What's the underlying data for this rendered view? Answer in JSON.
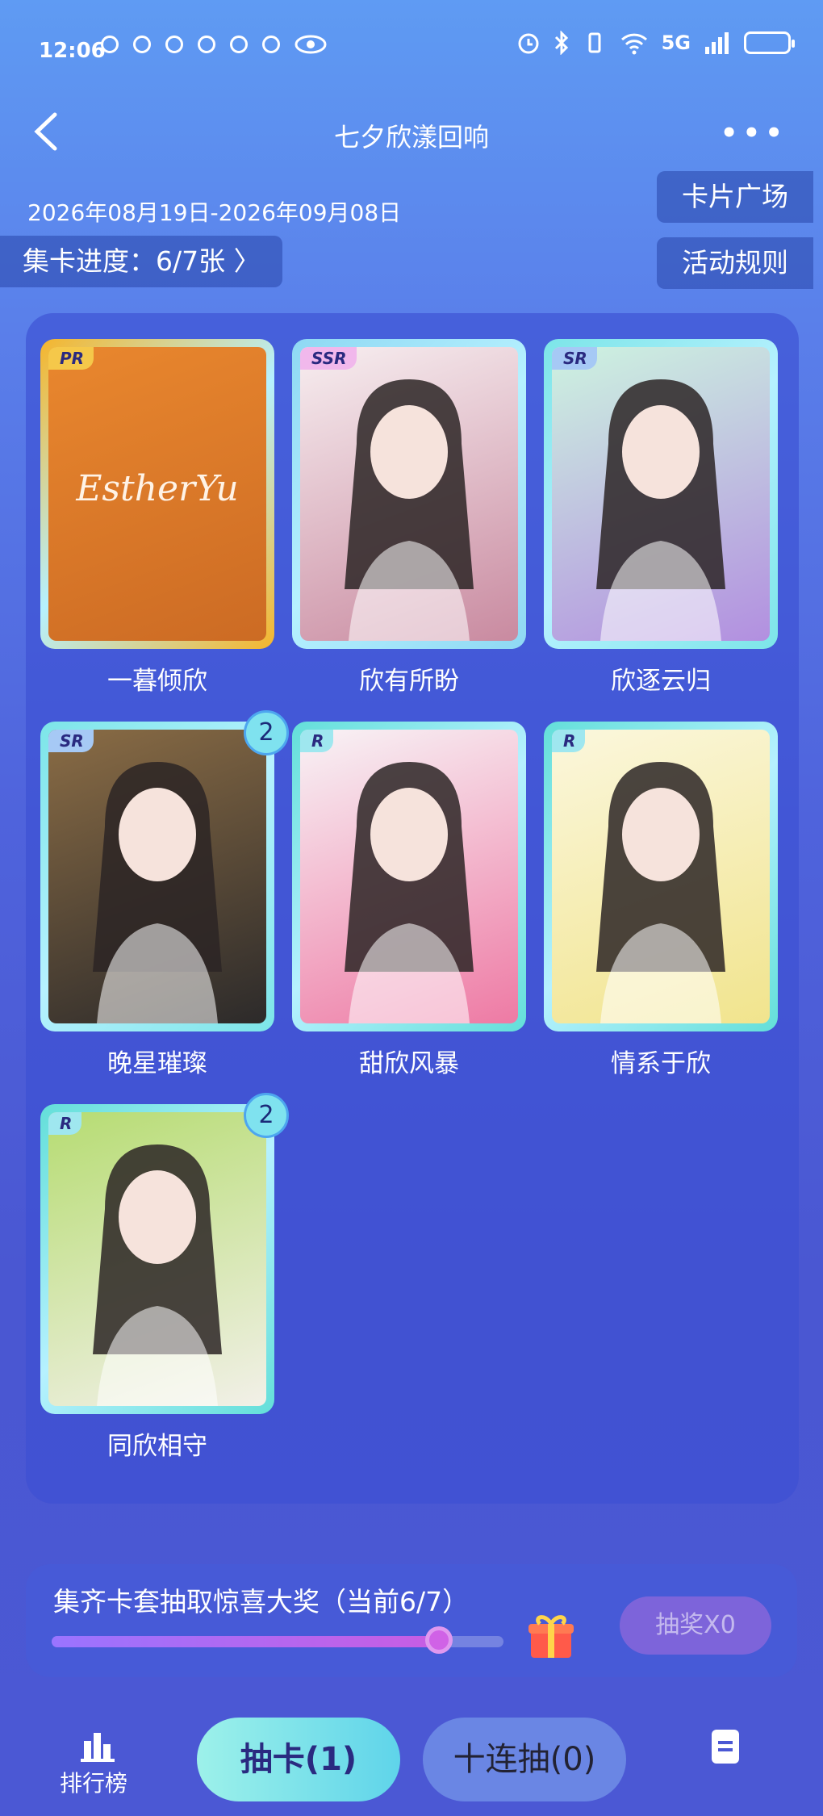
{
  "status_bar": {
    "time": "12:06",
    "network": "5G"
  },
  "header": {
    "title": "七夕欣漾回响",
    "more_label": "•••"
  },
  "event": {
    "date_range": "2026年08月19日-2026年09月08日",
    "progress_label": "集卡进度：6/7张 〉",
    "square_label": "卡片广场",
    "rules_label": "活动规则"
  },
  "cards": [
    {
      "name": "一暮倾欣",
      "rarity": "PR",
      "count": "",
      "cover_text": "EstherYu",
      "frame": "#f5b52c",
      "tag": "#f5c84a",
      "art_top": "#e9872e",
      "art_bottom": "#cc6b24"
    },
    {
      "name": "欣有所盼",
      "rarity": "SSR",
      "count": "",
      "cover_text": "",
      "frame": "#8ed8f3",
      "tag": "#f1b8ec",
      "art_top": "#f7eef0",
      "art_bottom": "#c98aa0"
    },
    {
      "name": "欣逐云归",
      "rarity": "SR",
      "count": "",
      "cover_text": "",
      "frame": "#7ce5e8",
      "tag": "#a6c9f5",
      "art_top": "#cdf3e0",
      "art_bottom": "#b28fe0"
    },
    {
      "name": "晚星璀璨",
      "rarity": "SR",
      "count": "2",
      "cover_text": "",
      "frame": "#7ce5e8",
      "tag": "#a6c9f5",
      "art_top": "#8a6c45",
      "art_bottom": "#2c2a2a"
    },
    {
      "name": "甜欣风暴",
      "rarity": "R",
      "count": "",
      "cover_text": "",
      "frame": "#63dfd9",
      "tag": "#9fe7ef",
      "art_top": "#f8f3f6",
      "art_bottom": "#ee7aa4"
    },
    {
      "name": "情系于欣",
      "rarity": "R",
      "count": "",
      "cover_text": "",
      "frame": "#63dfd9",
      "tag": "#9fe7ef",
      "art_top": "#fbf7dd",
      "art_bottom": "#f1e48d"
    },
    {
      "name": "同欣相守",
      "rarity": "R",
      "count": "2",
      "cover_text": "",
      "frame": "#63dfd9",
      "tag": "#9fe7ef",
      "art_top": "#b6dc72",
      "art_bottom": "#f2f0e8"
    }
  ],
  "prize": {
    "text": "集齐卡套抽取惊喜大奖（当前6/7）",
    "progress_fraction": 0.857,
    "draw_label": "抽奖X0"
  },
  "bottom_nav": {
    "rank_label": "排行榜",
    "draw_one_label": "抽卡(1)",
    "draw_ten_label": "十连抽(0)"
  },
  "colors": {
    "accent_cyan": "#5fd4ea",
    "prize_purple": "#c85de3"
  }
}
